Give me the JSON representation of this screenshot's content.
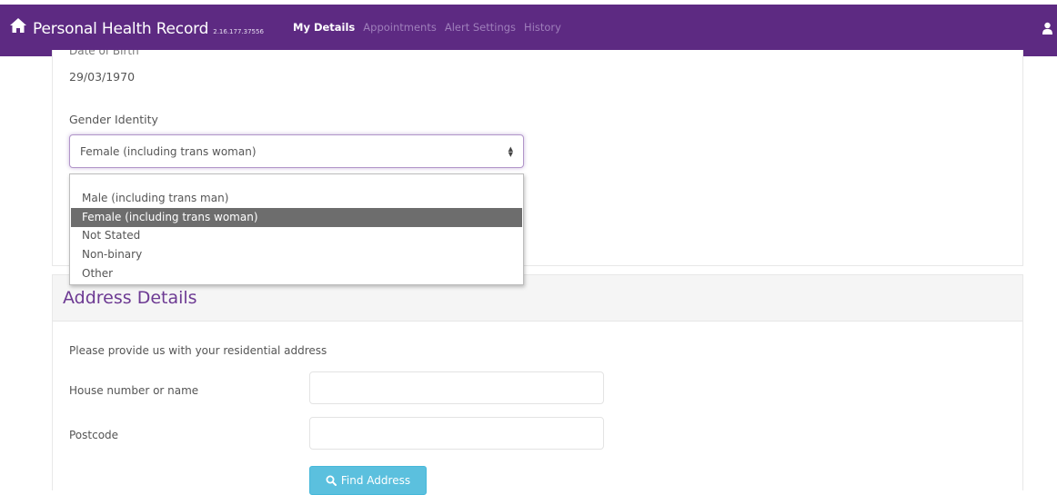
{
  "navbar": {
    "brand_title": "Personal Health Record",
    "brand_version": "2.16.177.37556",
    "links": [
      {
        "label": "My Details"
      },
      {
        "label": "Appointments"
      },
      {
        "label": "Alert Settings"
      },
      {
        "label": "History"
      }
    ],
    "active_link": "My Details",
    "icons": {
      "home": "home-icon",
      "user": "user-icon"
    },
    "colors": {
      "bar": "#5d2a82",
      "inactive_link": "#9f7fbb"
    }
  },
  "personal": {
    "dob_label": "Date of Birth",
    "dob_value": "29/03/1970",
    "gender_label": "Gender Identity",
    "gender_selected": "Female (including trans woman)",
    "gender_options": [
      "Male (including trans man)",
      "Female (including trans woman)",
      "Not Stated",
      "Non-binary",
      "Other"
    ]
  },
  "address": {
    "title": "Address Details",
    "intro": "Please provide us with your residential address",
    "house_label": "House number or name",
    "house_value": "",
    "postcode_label": "Postcode",
    "postcode_value": "",
    "find_button_label": "Find Address",
    "find_icon": "search-icon",
    "colors": {
      "title": "#6d3a93",
      "button": "#5bc0de"
    }
  }
}
